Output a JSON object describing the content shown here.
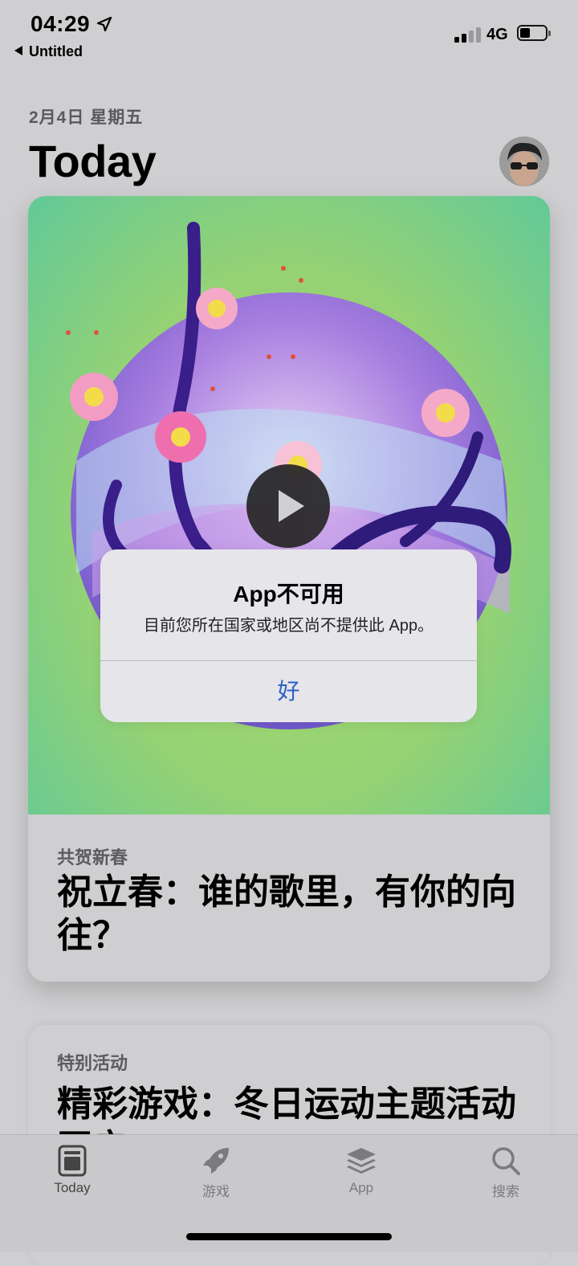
{
  "status_bar": {
    "time": "04:29",
    "back_app": "Untitled",
    "network": "4G"
  },
  "header": {
    "date": "2月4日 星期五",
    "title": "Today"
  },
  "featured_card": {
    "eyebrow": "共贺新春",
    "headline": "祝立春：谁的歌里，有你的向往？"
  },
  "second_card": {
    "eyebrow": "特别活动",
    "headline": "精彩游戏：冬日运动主题活动开启"
  },
  "alert": {
    "title": "App不可用",
    "message": "目前您所在国家或地区尚不提供此 App。",
    "ok_label": "好"
  },
  "tabs": [
    {
      "label": "Today",
      "icon": "today-icon",
      "active": true
    },
    {
      "label": "游戏",
      "icon": "rocket-icon",
      "active": false
    },
    {
      "label": "App",
      "icon": "app-stack-icon",
      "active": false
    },
    {
      "label": "搜索",
      "icon": "search-icon",
      "active": false
    }
  ],
  "colors": {
    "accent": "#2d62c8",
    "hero_green": "#95d274",
    "hero_teal": "#62c998"
  }
}
